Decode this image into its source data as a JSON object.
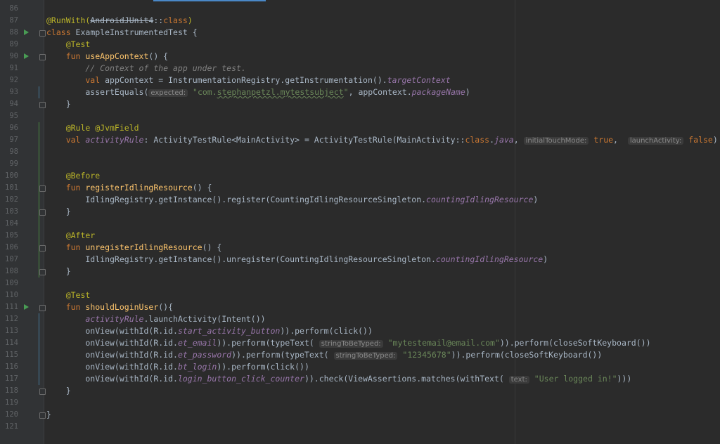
{
  "editor": {
    "accent_color": "#4a88c7",
    "lines": [
      {
        "num": "86",
        "run": false,
        "fold": false,
        "change": "",
        "tokens": []
      },
      {
        "num": "87",
        "run": false,
        "fold": false,
        "change": "",
        "tokens": [
          {
            "t": "@RunWith(",
            "c": "annotation"
          },
          {
            "t": "AndroidJUnit4",
            "c": "strike"
          },
          {
            "t": "::",
            "c": "default"
          },
          {
            "t": "class",
            "c": "keyword"
          },
          {
            "t": ")",
            "c": "annotation"
          }
        ]
      },
      {
        "num": "88",
        "run": true,
        "fold": true,
        "change": "",
        "tokens": [
          {
            "t": "class ",
            "c": "keyword"
          },
          {
            "t": "ExampleInstrumentedTest {",
            "c": "default"
          }
        ]
      },
      {
        "num": "89",
        "run": false,
        "fold": false,
        "change": "",
        "tokens": [
          {
            "t": "    @Test",
            "c": "annotation"
          }
        ]
      },
      {
        "num": "90",
        "run": true,
        "fold": true,
        "change": "",
        "tokens": [
          {
            "t": "    fun ",
            "c": "keyword"
          },
          {
            "t": "useAppContext",
            "c": "function"
          },
          {
            "t": "() {",
            "c": "default"
          }
        ]
      },
      {
        "num": "91",
        "run": false,
        "fold": false,
        "change": "",
        "tokens": [
          {
            "t": "        // Context of the app under test.",
            "c": "comment"
          }
        ]
      },
      {
        "num": "92",
        "run": false,
        "fold": false,
        "change": "",
        "tokens": [
          {
            "t": "        val ",
            "c": "keyword"
          },
          {
            "t": "appContext = InstrumentationRegistry.getInstrumentation().",
            "c": "default"
          },
          {
            "t": "targetContext",
            "c": "property"
          }
        ]
      },
      {
        "num": "93",
        "run": false,
        "fold": false,
        "change": "mod",
        "tokens": [
          {
            "t": "        assertEquals(",
            "c": "default"
          },
          {
            "t": "expected:",
            "c": "hint"
          },
          {
            "t": " ",
            "c": "default"
          },
          {
            "t": "\"com.",
            "c": "string"
          },
          {
            "t": "stephanpetzl.mytestsubject",
            "c": "string-ul"
          },
          {
            "t": "\"",
            "c": "string"
          },
          {
            "t": ", appContext.",
            "c": "default"
          },
          {
            "t": "packageName",
            "c": "property"
          },
          {
            "t": ")",
            "c": "default"
          }
        ]
      },
      {
        "num": "94",
        "run": false,
        "fold": true,
        "change": "",
        "tokens": [
          {
            "t": "    }",
            "c": "default"
          }
        ]
      },
      {
        "num": "95",
        "run": false,
        "fold": false,
        "change": "",
        "tokens": []
      },
      {
        "num": "96",
        "run": false,
        "fold": false,
        "change": "add",
        "tokens": [
          {
            "t": "    @Rule @JvmField",
            "c": "annotation"
          }
        ]
      },
      {
        "num": "97",
        "run": false,
        "fold": false,
        "change": "add",
        "tokens": [
          {
            "t": "    val ",
            "c": "keyword"
          },
          {
            "t": "activityRule",
            "c": "property"
          },
          {
            "t": ": ActivityTestRule<MainActivity> = ActivityTestRule(MainActivity::",
            "c": "default"
          },
          {
            "t": "class",
            "c": "keyword"
          },
          {
            "t": ".",
            "c": "default"
          },
          {
            "t": "java",
            "c": "property"
          },
          {
            "t": ", ",
            "c": "default"
          },
          {
            "t": "initialTouchMode:",
            "c": "hint"
          },
          {
            "t": " ",
            "c": "default"
          },
          {
            "t": "true",
            "c": "keyword"
          },
          {
            "t": ",  ",
            "c": "default"
          },
          {
            "t": "launchActivity:",
            "c": "hint"
          },
          {
            "t": " ",
            "c": "default"
          },
          {
            "t": "false",
            "c": "keyword"
          },
          {
            "t": ")",
            "c": "default"
          }
        ]
      },
      {
        "num": "98",
        "run": false,
        "fold": false,
        "change": "add",
        "tokens": []
      },
      {
        "num": "99",
        "run": false,
        "fold": false,
        "change": "add",
        "tokens": []
      },
      {
        "num": "100",
        "run": false,
        "fold": false,
        "change": "add",
        "tokens": [
          {
            "t": "    @Before",
            "c": "annotation"
          }
        ]
      },
      {
        "num": "101",
        "run": false,
        "fold": true,
        "change": "add",
        "tokens": [
          {
            "t": "    fun ",
            "c": "keyword"
          },
          {
            "t": "registerIdlingResource",
            "c": "function"
          },
          {
            "t": "() {",
            "c": "default"
          }
        ]
      },
      {
        "num": "102",
        "run": false,
        "fold": false,
        "change": "add",
        "tokens": [
          {
            "t": "        IdlingRegistry.getInstance().register(CountingIdlingResourceSingleton.",
            "c": "default"
          },
          {
            "t": "countingIdlingResource",
            "c": "property"
          },
          {
            "t": ")",
            "c": "default"
          }
        ]
      },
      {
        "num": "103",
        "run": false,
        "fold": true,
        "change": "add",
        "tokens": [
          {
            "t": "    }",
            "c": "default"
          }
        ]
      },
      {
        "num": "104",
        "run": false,
        "fold": false,
        "change": "add",
        "tokens": []
      },
      {
        "num": "105",
        "run": false,
        "fold": false,
        "change": "add",
        "tokens": [
          {
            "t": "    @After",
            "c": "annotation"
          }
        ]
      },
      {
        "num": "106",
        "run": false,
        "fold": true,
        "change": "add",
        "tokens": [
          {
            "t": "    fun ",
            "c": "keyword"
          },
          {
            "t": "unregisterIdlingResource",
            "c": "function"
          },
          {
            "t": "() {",
            "c": "default"
          }
        ]
      },
      {
        "num": "107",
        "run": false,
        "fold": false,
        "change": "add",
        "tokens": [
          {
            "t": "        IdlingRegistry.getInstance().unregister(CountingIdlingResourceSingleton.",
            "c": "default"
          },
          {
            "t": "countingIdlingResource",
            "c": "property"
          },
          {
            "t": ")",
            "c": "default"
          }
        ]
      },
      {
        "num": "108",
        "run": false,
        "fold": true,
        "change": "add",
        "tokens": [
          {
            "t": "    }",
            "c": "default"
          }
        ]
      },
      {
        "num": "109",
        "run": false,
        "fold": false,
        "change": "",
        "tokens": []
      },
      {
        "num": "110",
        "run": false,
        "fold": false,
        "change": "",
        "tokens": [
          {
            "t": "    @Test",
            "c": "annotation"
          }
        ]
      },
      {
        "num": "111",
        "run": true,
        "fold": true,
        "change": "",
        "tokens": [
          {
            "t": "    fun ",
            "c": "keyword"
          },
          {
            "t": "shouldLoginUser",
            "c": "function"
          },
          {
            "t": "(){",
            "c": "default"
          }
        ]
      },
      {
        "num": "112",
        "run": false,
        "fold": false,
        "change": "mod",
        "tokens": [
          {
            "t": "        ",
            "c": "default"
          },
          {
            "t": "activityRule",
            "c": "property"
          },
          {
            "t": ".launchActivity(Intent())",
            "c": "default"
          }
        ]
      },
      {
        "num": "113",
        "run": false,
        "fold": false,
        "change": "mod",
        "tokens": [
          {
            "t": "        onView(withId(R.id.",
            "c": "default"
          },
          {
            "t": "start_activity_button",
            "c": "property"
          },
          {
            "t": ")).perform(click())",
            "c": "default"
          }
        ]
      },
      {
        "num": "114",
        "run": false,
        "fold": false,
        "change": "mod",
        "tokens": [
          {
            "t": "        onView(withId(R.id.",
            "c": "default"
          },
          {
            "t": "et_email",
            "c": "property"
          },
          {
            "t": ")).perform(typeText( ",
            "c": "default"
          },
          {
            "t": "stringToBeTyped:",
            "c": "hint"
          },
          {
            "t": " ",
            "c": "default"
          },
          {
            "t": "\"mytestemail@email.com\"",
            "c": "string"
          },
          {
            "t": ")).perform(closeSoftKeyboard())",
            "c": "default"
          }
        ]
      },
      {
        "num": "115",
        "run": false,
        "fold": false,
        "change": "mod",
        "tokens": [
          {
            "t": "        onView(withId(R.id.",
            "c": "default"
          },
          {
            "t": "et_password",
            "c": "property"
          },
          {
            "t": ")).perform(typeText( ",
            "c": "default"
          },
          {
            "t": "stringToBeTyped:",
            "c": "hint"
          },
          {
            "t": " ",
            "c": "default"
          },
          {
            "t": "\"12345678\"",
            "c": "string"
          },
          {
            "t": ")).perform(closeSoftKeyboard())",
            "c": "default"
          }
        ]
      },
      {
        "num": "116",
        "run": false,
        "fold": false,
        "change": "mod",
        "tokens": [
          {
            "t": "        onView(withId(R.id.",
            "c": "default"
          },
          {
            "t": "bt_login",
            "c": "property"
          },
          {
            "t": ")).perform(click())",
            "c": "default"
          }
        ]
      },
      {
        "num": "117",
        "run": false,
        "fold": false,
        "change": "mod",
        "tokens": [
          {
            "t": "        onView(withId(R.id.",
            "c": "default"
          },
          {
            "t": "login_button_click_counter",
            "c": "property"
          },
          {
            "t": ")).check(ViewAssertions.matches(withText( ",
            "c": "default"
          },
          {
            "t": "text:",
            "c": "hint"
          },
          {
            "t": " ",
            "c": "default"
          },
          {
            "t": "\"User logged in!\"",
            "c": "string"
          },
          {
            "t": ")))",
            "c": "default"
          }
        ]
      },
      {
        "num": "118",
        "run": false,
        "fold": true,
        "change": "",
        "tokens": [
          {
            "t": "    }",
            "c": "default"
          }
        ]
      },
      {
        "num": "119",
        "run": false,
        "fold": false,
        "change": "",
        "tokens": []
      },
      {
        "num": "120",
        "run": false,
        "fold": true,
        "change": "",
        "tokens": [
          {
            "t": "}",
            "c": "default"
          }
        ]
      },
      {
        "num": "121",
        "run": false,
        "fold": false,
        "change": "",
        "tokens": []
      }
    ]
  }
}
